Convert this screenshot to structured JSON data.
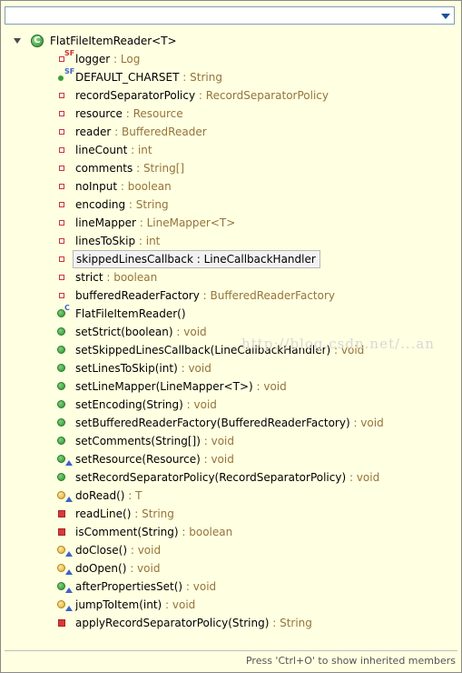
{
  "filter": {
    "value": "",
    "placeholder": ""
  },
  "root": {
    "label": "FlatFileItemReader<T>"
  },
  "members": [
    {
      "name": "logger",
      "type": "Log",
      "icon": "private-static-final-field-icon"
    },
    {
      "name": "DEFAULT_CHARSET",
      "type": "String",
      "icon": "public-static-final-field-icon"
    },
    {
      "name": "recordSeparatorPolicy",
      "type": "RecordSeparatorPolicy",
      "icon": "private-field-icon"
    },
    {
      "name": "resource",
      "type": "Resource",
      "icon": "private-field-icon"
    },
    {
      "name": "reader",
      "type": "BufferedReader",
      "icon": "private-field-icon"
    },
    {
      "name": "lineCount",
      "type": "int",
      "icon": "private-field-icon"
    },
    {
      "name": "comments",
      "type": "String[]",
      "icon": "private-field-icon"
    },
    {
      "name": "noInput",
      "type": "boolean",
      "icon": "private-field-icon"
    },
    {
      "name": "encoding",
      "type": "String",
      "icon": "private-field-icon"
    },
    {
      "name": "lineMapper",
      "type": "LineMapper<T>",
      "icon": "private-field-icon"
    },
    {
      "name": "linesToSkip",
      "type": "int",
      "icon": "private-field-icon"
    },
    {
      "name": "skippedLinesCallback",
      "type": "LineCallbackHandler",
      "icon": "private-field-icon",
      "selected": true
    },
    {
      "name": "strict",
      "type": "boolean",
      "icon": "private-field-icon"
    },
    {
      "name": "bufferedReaderFactory",
      "type": "BufferedReaderFactory",
      "icon": "private-field-icon"
    },
    {
      "name": "FlatFileItemReader()",
      "type": "",
      "icon": "constructor-icon"
    },
    {
      "name": "setStrict(boolean)",
      "type": "void",
      "icon": "public-method-icon"
    },
    {
      "name": "setSkippedLinesCallback(LineCallbackHandler)",
      "type": "void",
      "icon": "public-method-icon"
    },
    {
      "name": "setLinesToSkip(int)",
      "type": "void",
      "icon": "public-method-icon"
    },
    {
      "name": "setLineMapper(LineMapper<T>)",
      "type": "void",
      "icon": "public-method-icon"
    },
    {
      "name": "setEncoding(String)",
      "type": "void",
      "icon": "public-method-icon"
    },
    {
      "name": "setBufferedReaderFactory(BufferedReaderFactory)",
      "type": "void",
      "icon": "public-method-icon"
    },
    {
      "name": "setComments(String[])",
      "type": "void",
      "icon": "public-method-icon"
    },
    {
      "name": "setResource(Resource)",
      "type": "void",
      "icon": "public-override-method-icon"
    },
    {
      "name": "setRecordSeparatorPolicy(RecordSeparatorPolicy)",
      "type": "void",
      "icon": "public-method-icon"
    },
    {
      "name": "doRead()",
      "type": "T",
      "icon": "protected-override-method-icon"
    },
    {
      "name": "readLine()",
      "type": "String",
      "icon": "private-method-icon"
    },
    {
      "name": "isComment(String)",
      "type": "boolean",
      "icon": "private-method-icon"
    },
    {
      "name": "doClose()",
      "type": "void",
      "icon": "protected-override-method-icon"
    },
    {
      "name": "doOpen()",
      "type": "void",
      "icon": "protected-override-method-icon"
    },
    {
      "name": "afterPropertiesSet()",
      "type": "void",
      "icon": "public-override-method-icon"
    },
    {
      "name": "jumpToItem(int)",
      "type": "void",
      "icon": "protected-override-method-icon"
    },
    {
      "name": "applyRecordSeparatorPolicy(String)",
      "type": "String",
      "icon": "private-method-icon"
    }
  ],
  "watermark": "http://blog.csdn.net/...an",
  "status": "Press 'Ctrl+O' to show inherited members",
  "colors": {
    "background": "#ffffe1",
    "type_text": "#95743a",
    "public": "#2f8f2f",
    "private": "#d83a3a",
    "protected": "#d9a930"
  }
}
